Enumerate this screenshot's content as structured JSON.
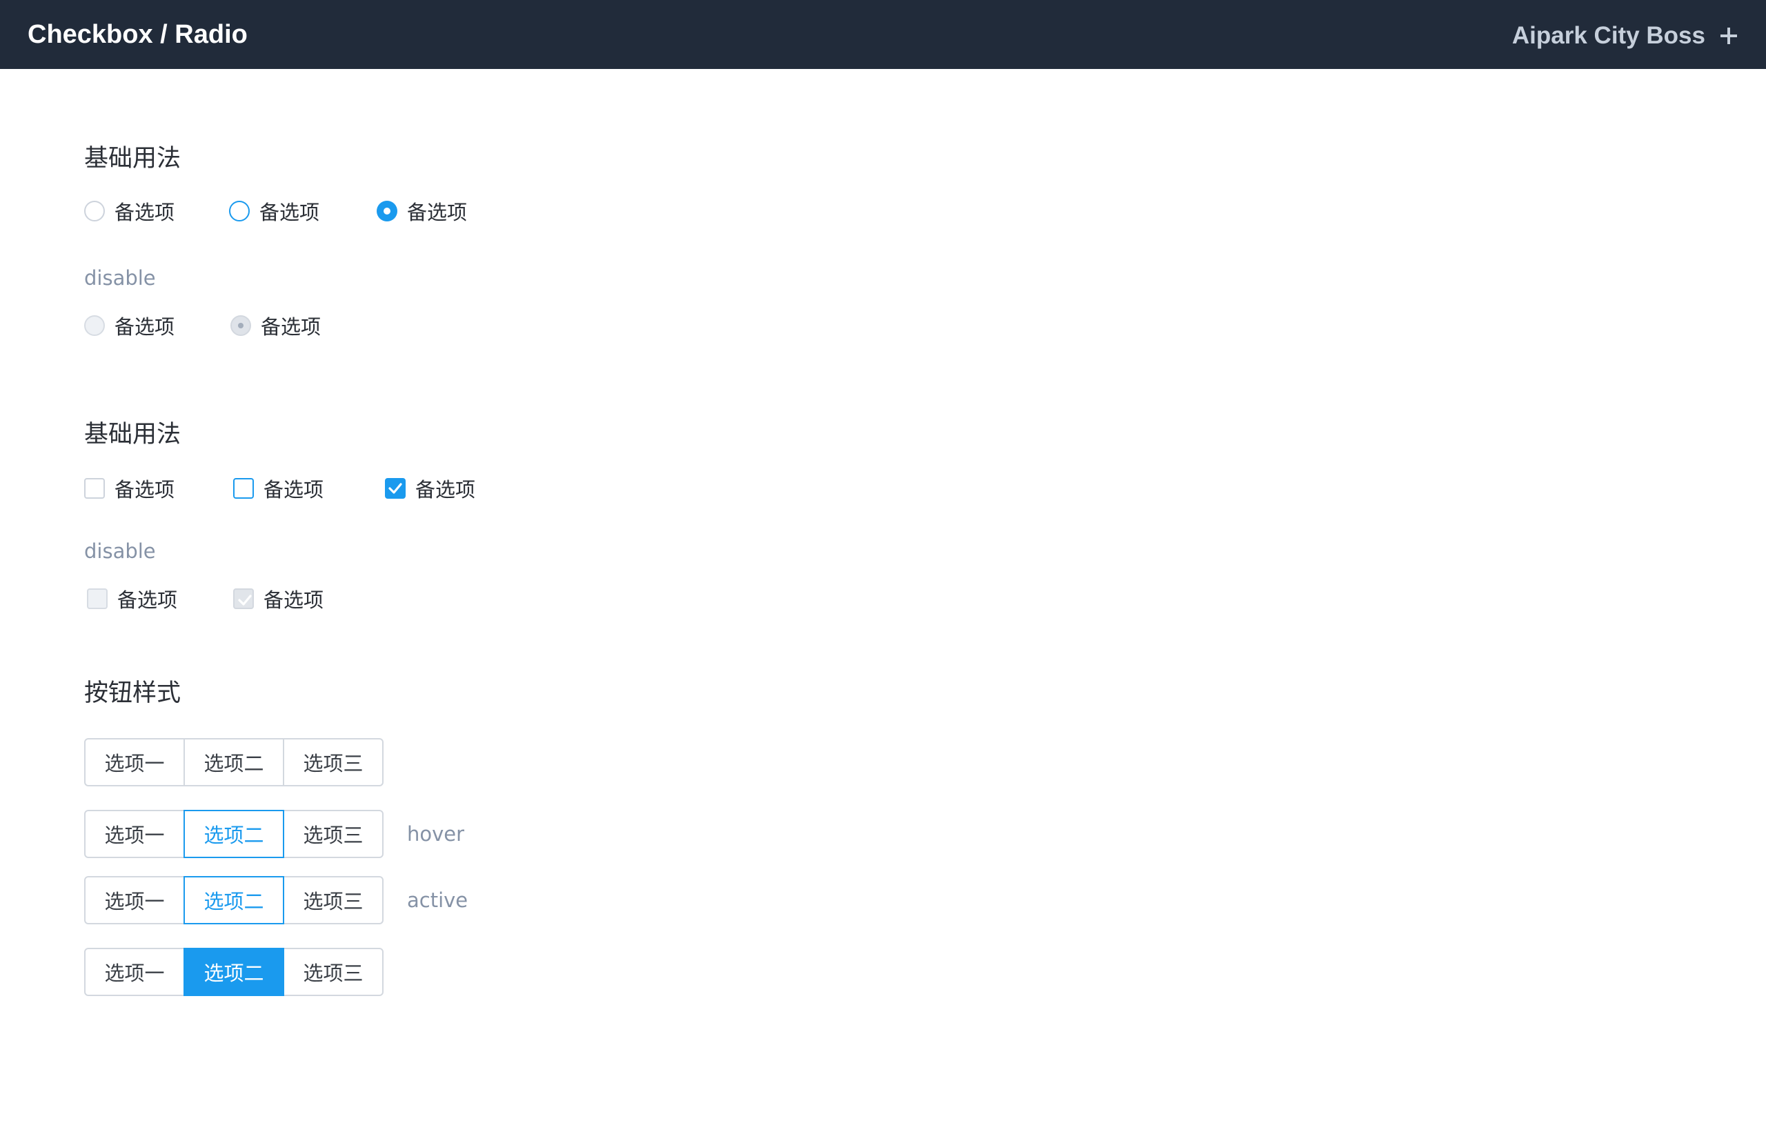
{
  "header": {
    "title": "Checkbox / Radio",
    "account": "Aipark City Boss"
  },
  "radio_section": {
    "title": "基础用法",
    "options": [
      {
        "label": "备选项",
        "state": "default"
      },
      {
        "label": "备选项",
        "state": "hover"
      },
      {
        "label": "备选项",
        "state": "checked"
      }
    ],
    "disable_label": "disable",
    "disabled_options": [
      {
        "label": "备选项",
        "state": "disabled"
      },
      {
        "label": "备选项",
        "state": "disabled-checked"
      }
    ]
  },
  "checkbox_section": {
    "title": "基础用法",
    "options": [
      {
        "label": "备选项",
        "state": "default"
      },
      {
        "label": "备选项",
        "state": "hover"
      },
      {
        "label": "备选项",
        "state": "checked"
      }
    ],
    "disable_label": "disable",
    "disabled_options": [
      {
        "label": "备选项",
        "state": "disabled"
      },
      {
        "label": "备选项",
        "state": "disabled-checked"
      }
    ]
  },
  "button_section": {
    "title": "按钮样式",
    "groups": [
      {
        "buttons": [
          "选项一",
          "选项二",
          "选项三"
        ],
        "highlighted_index": null,
        "state": "default",
        "note": ""
      },
      {
        "buttons": [
          "选项一",
          "选项二",
          "选项三"
        ],
        "highlighted_index": 1,
        "state": "hover",
        "note": "hover"
      },
      {
        "buttons": [
          "选项一",
          "选项二",
          "选项三"
        ],
        "highlighted_index": 1,
        "state": "active",
        "note": "active"
      },
      {
        "buttons": [
          "选项一",
          "选项二",
          "选项三"
        ],
        "highlighted_index": 1,
        "state": "selected",
        "note": ""
      }
    ]
  },
  "colors": {
    "header_bg": "#212b3a",
    "accent": "#1a9aee",
    "muted_text": "#8592a6",
    "border": "#d3d8df"
  }
}
